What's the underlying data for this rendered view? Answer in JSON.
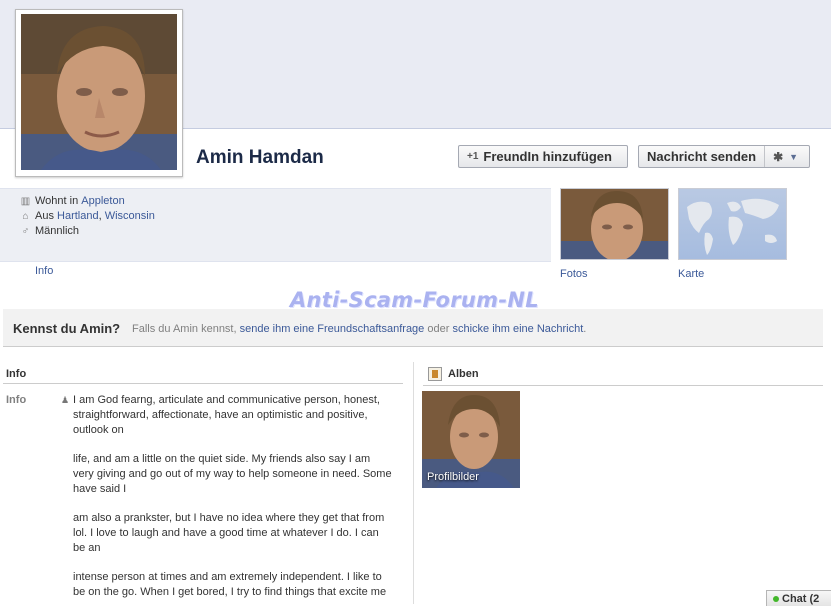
{
  "profile": {
    "name": "Amin Hamdan",
    "add_friend_label": "FreundIn hinzufügen",
    "message_label": "Nachricht senden"
  },
  "facts": {
    "lives_prefix": "Wohnt in",
    "lives_city": "Appleton",
    "from_prefix": "Aus",
    "from_city": "Hartland",
    "from_sep": ",",
    "from_state": "Wisconsin",
    "gender": "Männlich"
  },
  "tabs": {
    "info": "Info"
  },
  "thumbs": {
    "photos": "Fotos",
    "map": "Karte"
  },
  "watermark": "Anti-Scam-Forum-NL",
  "know": {
    "question": "Kennst du Amin?",
    "text_start": "Falls du Amin kennst,",
    "link1": "sende ihm eine Freundschaftsanfrage",
    "text_mid": "oder",
    "link2": "schicke ihm eine Nachricht",
    "text_end": "."
  },
  "info_section": {
    "heading": "Info",
    "label": "Info",
    "paragraphs": [
      "I am God fearng, articulate and communicative person, honest, straightforward, affectionate, have an optimistic and positive, outlook on",
      "life, and am a little on the quiet side. My friends also say I am very giving and go out of my way to help someone in need. Some have said I",
      "am also a prankster, but I have no idea where they get that from lol. I love to laugh and have a good time at whatever I do. I can be an",
      "intense person at times and am extremely independent. I like to be on the go. When I get bored, I try to find things that excite me"
    ]
  },
  "albums": {
    "heading": "Alben",
    "album_caption": "Profilbilder"
  },
  "chat": {
    "label": "Chat (2"
  },
  "colors": {
    "link": "#3b5998",
    "name": "#1c2a47",
    "cover": "#e9ebf3"
  }
}
